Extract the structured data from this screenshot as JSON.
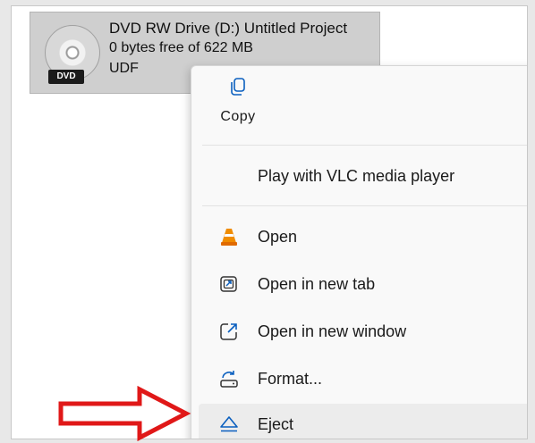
{
  "drive": {
    "title": "DVD RW Drive (D:) Untitled Project",
    "free_space": "0 bytes free of 622 MB",
    "filesystem": "UDF",
    "badge": "DVD",
    "icon": "dvd-disc-icon"
  },
  "context_menu": {
    "copy_label": "Copy",
    "items": [
      {
        "label": "Play with VLC media player",
        "icon": ""
      },
      {
        "label": "Open",
        "icon": "vlc-cone-icon"
      },
      {
        "label": "Open in new tab",
        "icon": "open-new-tab-icon"
      },
      {
        "label": "Open in new window",
        "icon": "open-new-window-icon"
      },
      {
        "label": "Format...",
        "icon": "format-drive-icon"
      },
      {
        "label": "Eject",
        "icon": "eject-icon",
        "selected": true
      }
    ]
  },
  "colors": {
    "accent": "#0a5fbf",
    "annotation_arrow": "#e01818",
    "vlc_orange": "#f08c00"
  }
}
